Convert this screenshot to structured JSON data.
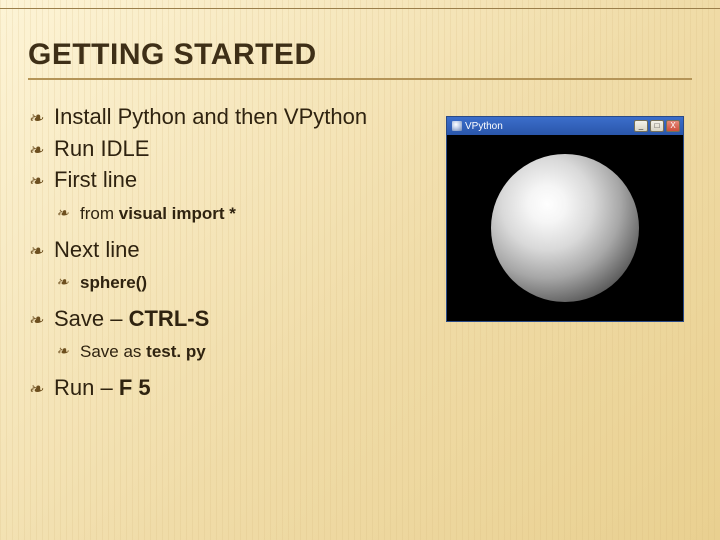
{
  "title": "GETTING STARTED",
  "items": {
    "install": "Install Python and then VPython",
    "run_idle": "Run IDLE",
    "first_line": "First line",
    "from_visual": {
      "pre": "from ",
      "bold": "visual import *"
    },
    "next_line": "Next line",
    "sphere_call": "sphere()",
    "save": {
      "pre": "Save – ",
      "bold": "CTRL-S"
    },
    "save_as": {
      "pre": "Save as ",
      "bold": "test. py"
    },
    "run_f5": {
      "pre": "Run – ",
      "bold": "F 5"
    }
  },
  "vpwin": {
    "title": "VPython",
    "btn_min": "_",
    "btn_max": "□",
    "btn_close": "X"
  },
  "bullets": {
    "l1": "་",
    "l2": "་"
  }
}
